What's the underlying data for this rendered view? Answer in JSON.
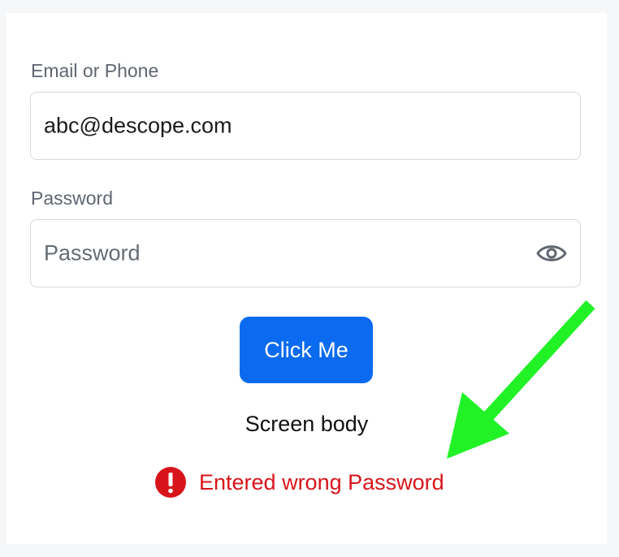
{
  "form": {
    "email_label": "Email or Phone",
    "email_value": "abc@descope.com",
    "password_label": "Password",
    "password_placeholder": "Password",
    "password_toggle_icon": "eye-icon",
    "submit_label": "Click Me",
    "body_text": "Screen body",
    "error_icon": "error-icon",
    "error_message": "Entered wrong Password"
  },
  "colors": {
    "accent": "#0a6bf0",
    "error": "#d8141b",
    "annotation": "#21f226"
  }
}
